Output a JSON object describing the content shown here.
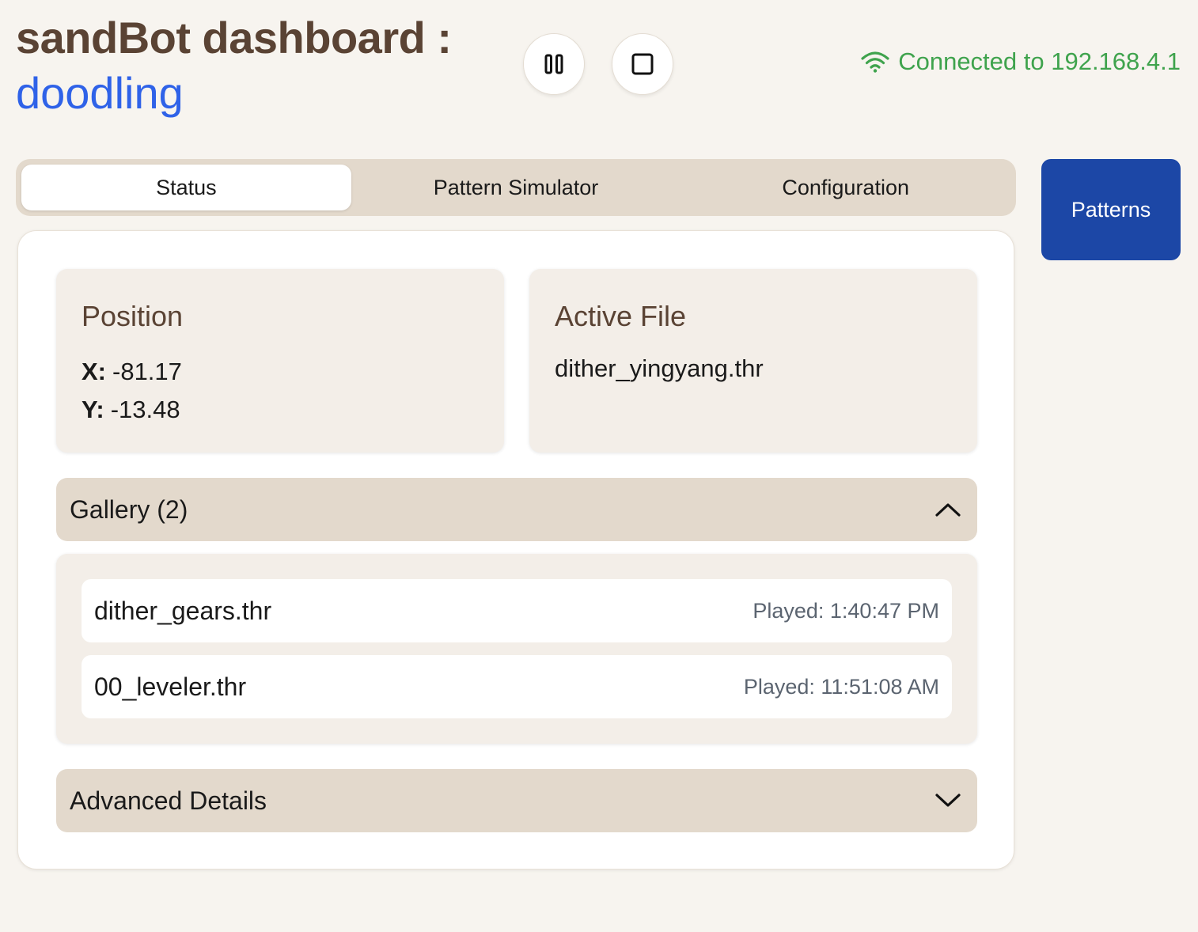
{
  "header": {
    "title": "sandBot dashboard :",
    "subtitle": "doodling",
    "pause_icon": "pause-icon",
    "stop_icon": "stop-icon",
    "connection": {
      "icon": "wifi-icon",
      "text": "Connected to 192.168.4.1",
      "color": "#3fa34d"
    }
  },
  "tabs": [
    {
      "label": "Status",
      "active": true
    },
    {
      "label": "Pattern Simulator",
      "active": false
    },
    {
      "label": "Configuration",
      "active": false
    }
  ],
  "patterns_button": {
    "label": "Patterns",
    "color": "#1c47a6"
  },
  "status": {
    "position": {
      "title": "Position",
      "x_label": "X:",
      "x_value": "-81.17",
      "y_label": "Y:",
      "y_value": "-13.48"
    },
    "active_file": {
      "title": "Active File",
      "value": "dither_yingyang.thr"
    },
    "gallery": {
      "title": "Gallery (2)",
      "expanded": true,
      "toggle_icon": "chevron-up-icon",
      "items": [
        {
          "name": "dither_gears.thr",
          "played": "Played: 1:40:47 PM"
        },
        {
          "name": "00_leveler.thr",
          "played": "Played: 11:51:08 AM"
        }
      ]
    },
    "advanced": {
      "title": "Advanced Details",
      "expanded": false,
      "toggle_icon": "chevron-down-icon"
    }
  }
}
